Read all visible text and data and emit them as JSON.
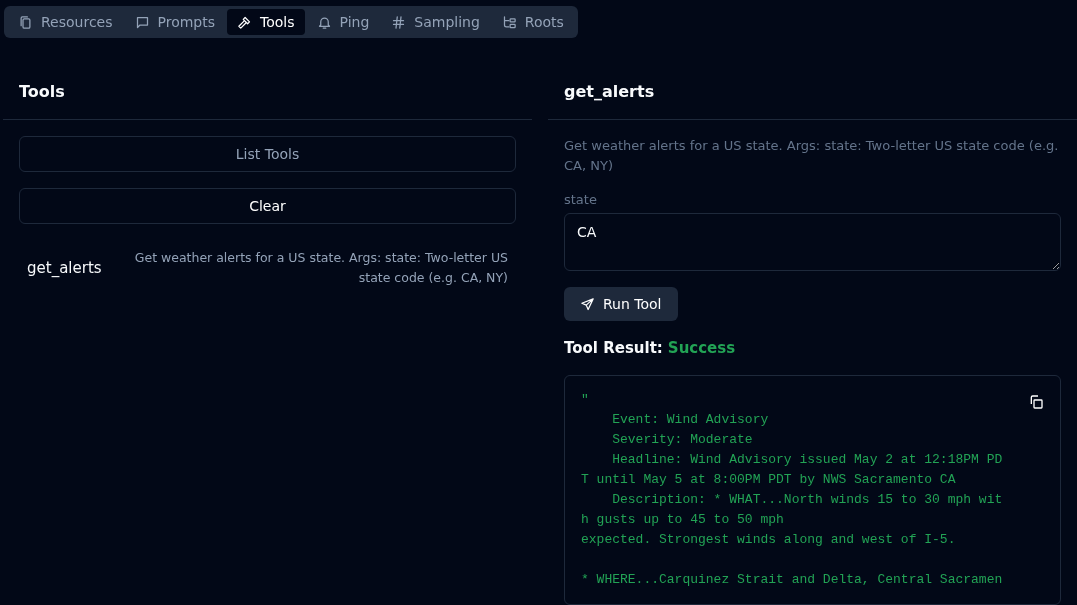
{
  "tabs": [
    {
      "label": "Resources",
      "kind": "resources",
      "selected": false
    },
    {
      "label": "Prompts",
      "kind": "prompts",
      "selected": false
    },
    {
      "label": "Tools",
      "kind": "tools",
      "selected": true
    },
    {
      "label": "Ping",
      "kind": "ping",
      "selected": false
    },
    {
      "label": "Sampling",
      "kind": "sampling",
      "selected": false
    },
    {
      "label": "Roots",
      "kind": "roots",
      "selected": false
    }
  ],
  "tools_panel": {
    "title": "Tools",
    "list_button": "List Tools",
    "clear_button": "Clear",
    "tools": [
      {
        "name": "get_alerts",
        "description": "Get weather alerts for a US state. Args: state: Two-letter US state code (e.g. CA, NY)"
      }
    ]
  },
  "tool_panel": {
    "title": "get_alerts",
    "description": "Get weather alerts for a US state. Args: state: Two-letter US state code (e.g. CA, NY)",
    "field_label": "state",
    "field_value": "CA",
    "run_button": "Run Tool",
    "result_label": "Tool Result:",
    "result_status": "Success",
    "result_text": "\"\n    Event: Wind Advisory\n    Severity: Moderate\n    Headline: Wind Advisory issued May 2 at 12:18PM PD\nT until May 5 at 8:00PM PDT by NWS Sacramento CA\n    Description: * WHAT...North winds 15 to 30 mph wit\nh gusts up to 45 to 50 mph\nexpected. Strongest winds along and west of I-5.\n\n* WHERE...Carquinez Strait and Delta, Central Sacramen"
  }
}
